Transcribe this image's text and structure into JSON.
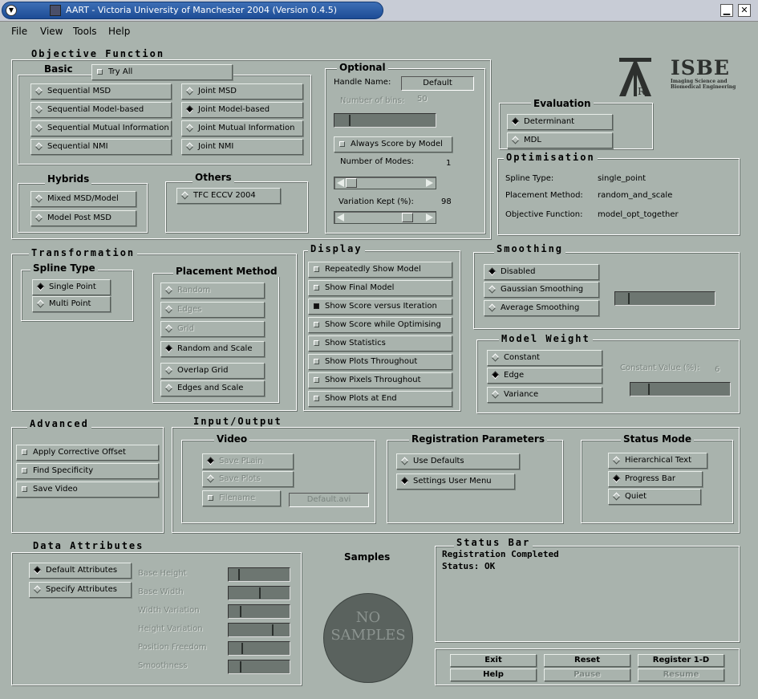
{
  "window": {
    "title": "AART - Victoria University of Manchester 2004 (Version 0.4.5)"
  },
  "menu": [
    "File",
    "View",
    "Tools",
    "Help"
  ],
  "objective": {
    "title": "Objective Function",
    "basic_title": "Basic",
    "try_all": "Try All",
    "basic_left": [
      "Sequential MSD",
      "Sequential Model-based",
      "Sequential Mutual Information",
      "Sequential NMI"
    ],
    "basic_right": [
      "Joint MSD",
      "Joint Model-based",
      "Joint Mutual Information",
      "Joint NMI"
    ],
    "selected": "Joint Model-based",
    "hybrids_title": "Hybrids",
    "hybrids": [
      "Mixed MSD/Model",
      "Model Post MSD"
    ],
    "others_title": "Others",
    "others": [
      "TFC ECCV 2004"
    ]
  },
  "optional": {
    "title": "Optional",
    "handle_label": "Handle Name:",
    "handle_value": "Default",
    "num_bins_label": "Number of bins:",
    "num_bins_value": "50",
    "always_score": "Always Score by Model",
    "modes_label": "Number of Modes:",
    "modes_value": "1",
    "variation_label": "Variation Kept (%):",
    "variation_value": "98"
  },
  "logo": {
    "isbe": "ISBE",
    "isbe_sub1": "Imaging Science and",
    "isbe_sub2": "Biomedical Engineering"
  },
  "evaluation": {
    "title": "Evaluation",
    "options": [
      "Determinant",
      "MDL"
    ],
    "selected": "Determinant"
  },
  "optimisation": {
    "title": "Optimisation",
    "rows": [
      {
        "k": "Spline Type:",
        "v": "single_point"
      },
      {
        "k": "Placement Method:",
        "v": "random_and_scale"
      },
      {
        "k": "Objective Function:",
        "v": "model_opt_together"
      }
    ]
  },
  "transformation": {
    "title": "Transformation",
    "spline_title": "Spline Type",
    "spline": [
      "Single Point",
      "Multi Point"
    ],
    "spline_selected": "Single Point",
    "placement_title": "Placement Method",
    "placement": [
      "Random",
      "Edges",
      "Grid",
      "Random and Scale",
      "Overlap Grid",
      "Edges and Scale"
    ],
    "placement_selected": "Random and Scale"
  },
  "display": {
    "title": "Display",
    "items": [
      "Repeatedly Show Model",
      "Show Final Model",
      "Show Score versus Iteration",
      "Show Score while Optimising",
      "Show Statistics",
      "Show Plots Throughout",
      "Show Pixels Throughout",
      "Show Plots at End"
    ],
    "checked": "Show Score versus Iteration"
  },
  "smoothing": {
    "title": "Smoothing",
    "options": [
      "Disabled",
      "Gaussian Smoothing",
      "Average Smoothing"
    ],
    "selected": "Disabled"
  },
  "model_weight": {
    "title": "Model Weight",
    "options": [
      "Constant",
      "Edge",
      "Variance"
    ],
    "selected": "Edge",
    "const_label": "Constant Value (%):",
    "const_value": "6"
  },
  "advanced": {
    "title": "Advanced",
    "items": [
      "Apply Corrective Offset",
      "Find Specificity",
      "Save Video"
    ]
  },
  "io": {
    "title": "Input/Output",
    "video_title": "Video",
    "video": [
      "Save PLain",
      "Save Plots",
      "Filename"
    ],
    "filename_value": "Default.avi",
    "reg_title": "Registration Parameters",
    "reg": [
      "Use Defaults",
      "Settings User Menu"
    ],
    "reg_selected": "Settings User Menu",
    "status_title": "Status Mode",
    "status": [
      "Hierarchical Text",
      "Progress Bar",
      "Quiet"
    ],
    "status_selected": "Progress Bar"
  },
  "data_attributes": {
    "title": "Data Attributes",
    "options": [
      "Default Attributes",
      "Specify Attributes"
    ],
    "selected": "Default Attributes",
    "params": [
      "Base Height",
      "Base Width",
      "Width Variation",
      "Height Variation",
      "Position Freedom",
      "Smoothness"
    ]
  },
  "samples": {
    "title": "Samples",
    "line1": "NO",
    "line2": "SAMPLES"
  },
  "status_bar": {
    "title": "Status Bar",
    "line1": "Registration Completed",
    "line2": "Status: OK"
  },
  "actions": {
    "row1": [
      "Exit",
      "Reset",
      "Register 1-D"
    ],
    "row2": [
      "Help",
      "Pause",
      "Resume"
    ]
  },
  "colors": {
    "bg": "#a9b3ad",
    "title_blue": "#2a5ca5",
    "samples_circle": "#5a625e"
  }
}
